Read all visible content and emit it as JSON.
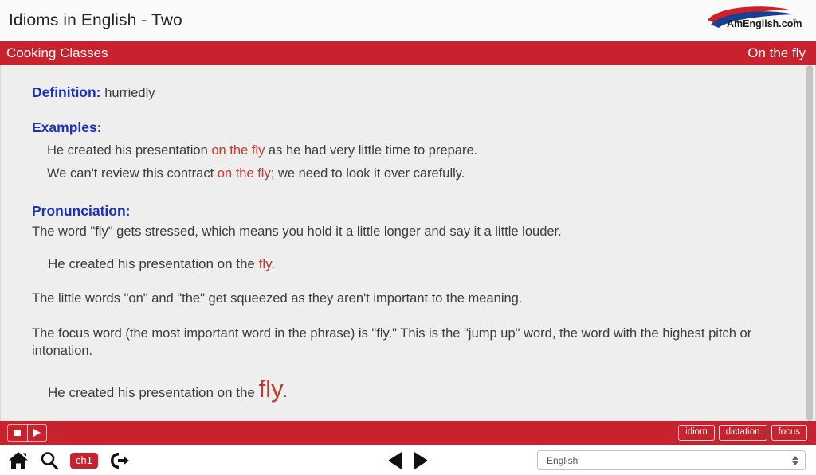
{
  "window": {
    "title": "Idioms in English - Two",
    "logo_text": "AmEnglish.com",
    "logo_mark": "amenglish-swoosh-logo"
  },
  "topic_bar": {
    "course": "Cooking Classes",
    "idiom": "On the fly"
  },
  "content": {
    "definition_label": "Definition:",
    "definition_text": "hurriedly",
    "examples_label": "Examples:",
    "examples": [
      {
        "before": "He created his presentation ",
        "highlight": "on the fly",
        "after": " as he had very little time to prepare."
      },
      {
        "before": "We can't review this contract ",
        "highlight": "on the fly",
        "after": "; we need to look it over carefully."
      }
    ],
    "pronunciation_label": "Pronunciation:",
    "pronunciation_note": "The word \"fly\" gets stressed, which means you hold it a little longer and say it a little louder.",
    "stress_example": {
      "before": "He created his presentation on the ",
      "highlight": "fly",
      "after": "."
    },
    "paragraph_squeezed": "The little words \"on\" and \"the\" get squeezed as they aren't important to the meaning.",
    "paragraph_focus": "The focus word (the most important word in the phrase) is \"fly.\" This is the \"jump up\" word, the word with the highest pitch or intonation.",
    "final_example": {
      "before": "He created his presentation on the ",
      "highlight": "fly",
      "after": "."
    }
  },
  "player_bar": {
    "stop_label": "stop-button",
    "play_label": "play-button",
    "modes": [
      {
        "label": "idiom"
      },
      {
        "label": "dictation"
      },
      {
        "label": "focus"
      }
    ]
  },
  "nav_bar": {
    "home_label": "home-icon",
    "search_label": "search-icon",
    "chapter_badge": "ch1",
    "exit_label": "exit-icon",
    "prev_label": "previous-button",
    "next_label": "next-button",
    "language_value": "English"
  },
  "colors": {
    "brand_red": "#c9222f",
    "heading_blue": "#1a33b4",
    "highlight_red": "#c0392f",
    "content_bg": "#eeeeee"
  }
}
